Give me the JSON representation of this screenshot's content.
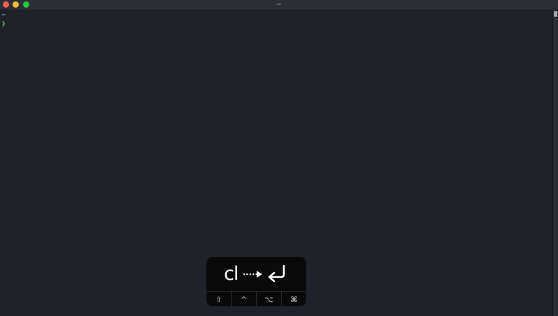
{
  "window": {
    "title": "~"
  },
  "terminal": {
    "current_dir": "~",
    "prompt_symbol": "❯"
  },
  "keycastr": {
    "typed": "cl",
    "modifiers": [
      {
        "name": "shift",
        "symbol": "⇧"
      },
      {
        "name": "control",
        "symbol": "^"
      },
      {
        "name": "option",
        "symbol": "⌥"
      },
      {
        "name": "command",
        "symbol": "⌘"
      }
    ]
  },
  "colors": {
    "background": "#1f2229",
    "dir_color": "#5bc4f5",
    "prompt_color": "#5fd35f",
    "close": "#ff5f57",
    "minimize": "#febc2e",
    "zoom": "#28c840"
  },
  "icons": {
    "arrow": "dotted-right-arrow-icon",
    "enter": "return-key-icon"
  }
}
